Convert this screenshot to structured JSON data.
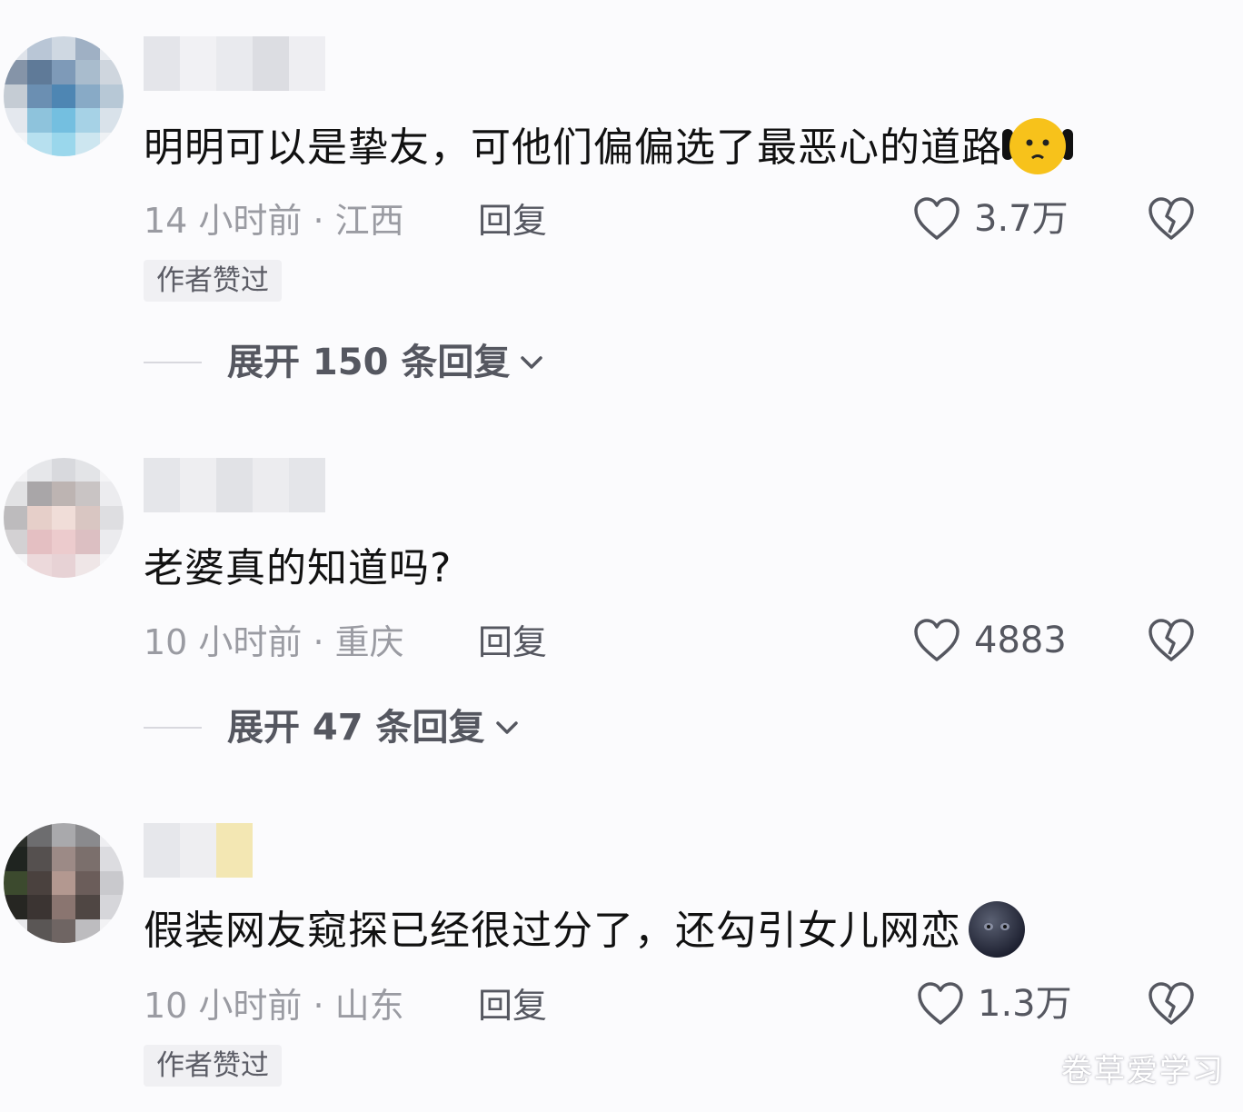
{
  "comments": [
    {
      "text": "明明可以是挚友，可他们偏偏选了最恶心的道路",
      "emoji": "worried-face-emoji",
      "time_location": "14 小时前 · 江西",
      "reply_label": "回复",
      "likes": "3.7万",
      "author_liked_badge": "作者赞过",
      "expand_label": "展开 150 条回复"
    },
    {
      "text": "老婆真的知道吗?",
      "time_location": "10 小时前 · 重庆",
      "reply_label": "回复",
      "likes": "4883",
      "expand_label": "展开 47 条回复"
    },
    {
      "text": "假装网友窥探已经很过分了，还勾引女儿网恋",
      "emoji": "dark-face-emoji",
      "time_location": "10 小时前 · 山东",
      "reply_label": "回复",
      "likes": "1.3万",
      "author_liked_badge": "作者赞过"
    }
  ],
  "watermark": "卷草爱学习",
  "colors": {
    "text_primary": "#111111",
    "text_secondary": "#9a9ba2",
    "background": "#fbfbfd",
    "badge_bg": "#f0f0f3"
  }
}
